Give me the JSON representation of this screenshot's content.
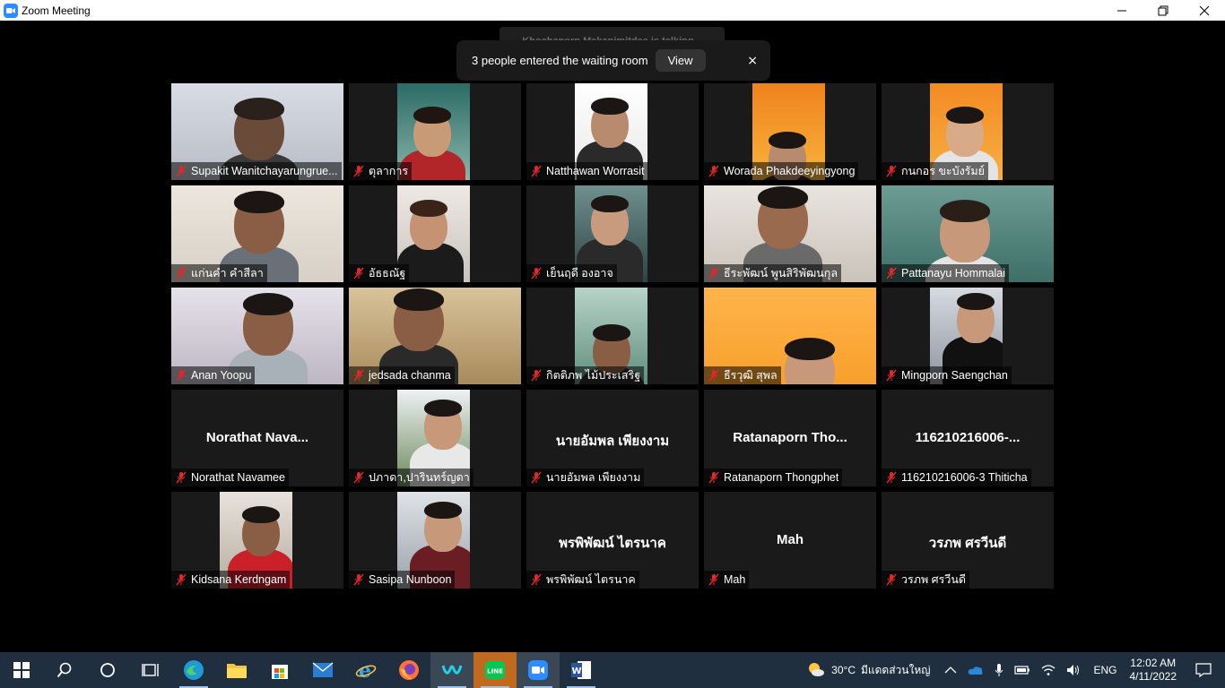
{
  "window": {
    "title": "Zoom Meeting"
  },
  "talking_indicator": "Khochaporn Mekanimitdee is talking...",
  "notification": {
    "message": "3 people entered the waiting room",
    "view_label": "View",
    "close_symbol": "×"
  },
  "participants": [
    {
      "name": "Supakit Wanitchayarungrue...",
      "muted": true,
      "video": true
    },
    {
      "name": "ตุลาการ",
      "muted": true,
      "video": true
    },
    {
      "name": "Natthawan Worrasit",
      "muted": true,
      "video": true
    },
    {
      "name": "Worada Phakdeeyingyong",
      "muted": true,
      "video": true
    },
    {
      "name": "กนกอร ขะบังรัมย์",
      "muted": true,
      "video": true
    },
    {
      "name": "แก่นคำ คำสีลา",
      "muted": true,
      "video": true
    },
    {
      "name": "อัธธณัฐ",
      "muted": true,
      "video": true
    },
    {
      "name": "เย็นฤดี องอาจ",
      "muted": true,
      "video": true
    },
    {
      "name": "ธีระพัฒน์ พูนสิริพัฒนกุล",
      "muted": true,
      "video": true
    },
    {
      "name": "Pattanayu Hommalai",
      "muted": true,
      "video": true
    },
    {
      "name": "Anan Yoopu",
      "muted": true,
      "video": true
    },
    {
      "name": "jedsada chanma",
      "muted": true,
      "video": true
    },
    {
      "name": "กิตติภพ ไม้ประเสริฐ",
      "muted": true,
      "video": true
    },
    {
      "name": "ธีรวุฒิ สุพล",
      "muted": true,
      "video": true
    },
    {
      "name": "Mingporn Saengchan",
      "muted": true,
      "video": true
    },
    {
      "name": "Norathat Navamee",
      "display": "Norathat  Nava...",
      "muted": true,
      "video": false
    },
    {
      "name": "ปภาดา,ปารินทร์ญดา",
      "muted": true,
      "video": true
    },
    {
      "name": "นายอัมพล เพียงงาม",
      "display": "นายอัมพล เพียงงาม",
      "muted": true,
      "video": false
    },
    {
      "name": "Ratanaporn Thongphet",
      "display": "Ratanaporn  Tho...",
      "muted": true,
      "video": false
    },
    {
      "name": "116210216006-3 Thiticha",
      "display": "116210216006-...",
      "muted": true,
      "video": false
    },
    {
      "name": "Kidsana Kerdngam",
      "muted": true,
      "video": true
    },
    {
      "name": "Sasipa Nunboon",
      "muted": true,
      "video": true
    },
    {
      "name": "พรพิพัฒน์ ไตรนาค",
      "display": "พรพิพัฒน์ ไตรนาค",
      "muted": true,
      "video": false
    },
    {
      "name": "Mah",
      "display": "Mah",
      "muted": true,
      "video": false
    },
    {
      "name": "วรภพ ศรวีนดี",
      "display": "วรภพ ศรวีนดี",
      "muted": true,
      "video": false
    }
  ],
  "taskbar": {
    "apps": [
      "start-icon",
      "search-icon",
      "cortana-icon",
      "task-view-icon",
      "edge-icon",
      "file-explorer-icon",
      "store-icon",
      "mail-icon",
      "ie-icon",
      "firefox-icon",
      "webex-icon",
      "line-icon",
      "zoom-icon",
      "word-icon"
    ],
    "weather_temp": "30°C",
    "weather_desc": "มีแดดส่วนใหญ่",
    "language": "ENG",
    "time": "12:02 AM",
    "date": "4/11/2022"
  },
  "colors": {
    "taskbar": "#1f2f3f",
    "zoom_blue": "#2d8cff",
    "muted_red": "#e02828",
    "tile_bg": "#1a1a1a"
  }
}
